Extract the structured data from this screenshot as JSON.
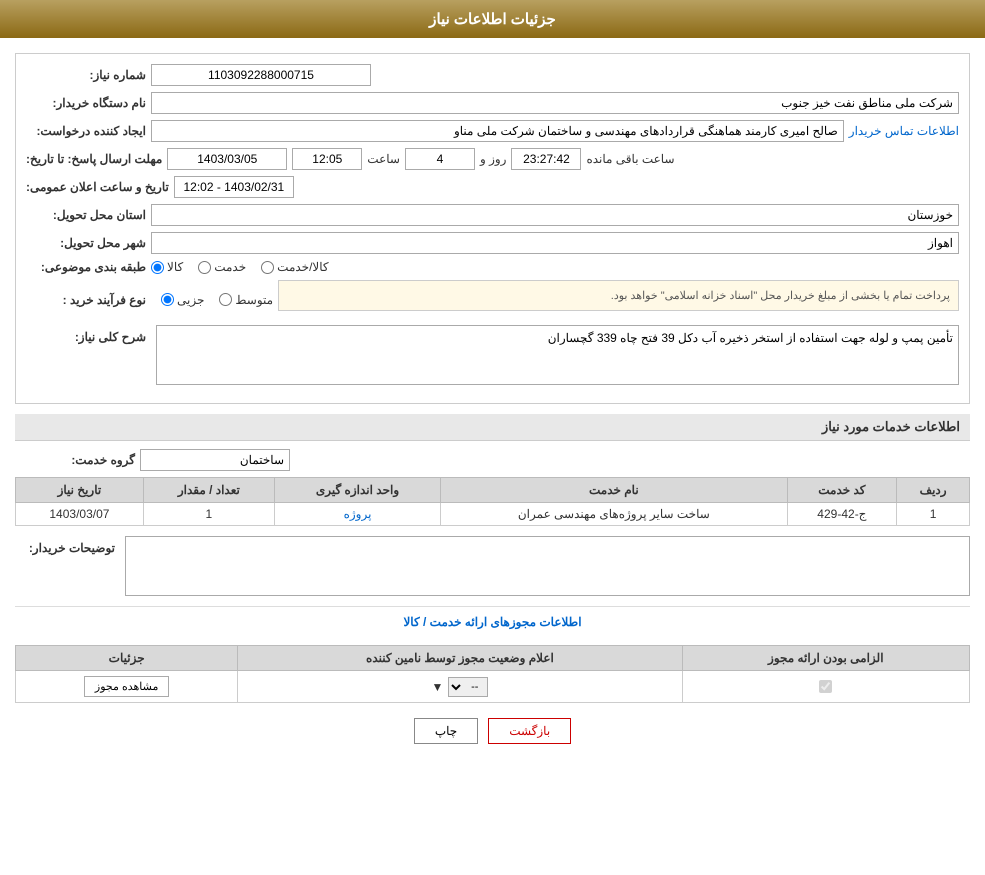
{
  "header": {
    "title": "جزئیات اطلاعات نیاز"
  },
  "form": {
    "need_number_label": "شماره نیاز:",
    "need_number_value": "1103092288000715",
    "requester_org_label": "نام دستگاه خریدار:",
    "requester_org_value": "شرکت ملی مناطق نفت خیز جنوب",
    "creator_label": "ایجاد کننده درخواست:",
    "creator_value": "صالح امیری کارمند هماهنگی قراردادهای مهندسی و ساختمان شرکت ملی مناو",
    "creator_link": "اطلاعات تماس خریدار",
    "reply_deadline_label": "مهلت ارسال پاسخ: تا تاریخ:",
    "announce_datetime_label": "تاریخ و ساعت اعلان عمومی:",
    "announce_datetime_value": "1403/02/31 - 12:02",
    "date_value": "1403/03/05",
    "time_value": "12:05",
    "days_value": "4",
    "hours_value": "23:27:42",
    "remaining_label": "ساعت باقی مانده",
    "days_label": "روز و",
    "time_label": "ساعت",
    "province_label": "استان محل تحویل:",
    "province_value": "خوزستان",
    "city_label": "شهر محل تحویل:",
    "city_value": "اهواز",
    "category_label": "طبقه بندی موضوعی:",
    "category_options": [
      "کالا",
      "خدمت",
      "کالا/خدمت"
    ],
    "category_selected": "کالا",
    "purchase_type_label": "نوع فرآیند خرید :",
    "purchase_options": [
      "جزیی",
      "متوسط"
    ],
    "purchase_note": "پرداخت تمام یا بخشی از مبلغ خریدار محل \"اسناد خزانه اسلامی\" خواهد بود.",
    "description_label": "شرح کلی نیاز:",
    "description_value": "تأمین پمپ و لوله جهت استفاده از استخر ذخیره آب دکل 39 فتح چاه 339 گچساران"
  },
  "services_section": {
    "title": "اطلاعات خدمات مورد نیاز",
    "service_group_label": "گروه خدمت:",
    "service_group_value": "ساختمان",
    "table": {
      "columns": [
        "ردیف",
        "کد خدمت",
        "نام خدمت",
        "واحد اندازه گیری",
        "تعداد / مقدار",
        "تاریخ نیاز"
      ],
      "rows": [
        {
          "row_num": "1",
          "service_code": "ج-42-429",
          "service_name": "ساخت سایر پروژه‌های مهندسی عمران",
          "unit": "پروژه",
          "quantity": "1",
          "date": "1403/03/07"
        }
      ]
    }
  },
  "buyer_notes": {
    "label": "توضیحات خریدار:",
    "value": ""
  },
  "license_section": {
    "title": "اطلاعات مجوزهای ارائه خدمت / کالا",
    "table": {
      "columns": [
        "الزامی بودن ارائه مجوز",
        "اعلام وضعیت مجوز توسط نامین کننده",
        "جزئیات"
      ],
      "rows": [
        {
          "required": true,
          "status": "--",
          "details_btn": "مشاهده مجوز"
        }
      ]
    }
  },
  "footer": {
    "print_label": "چاپ",
    "back_label": "بازگشت"
  }
}
